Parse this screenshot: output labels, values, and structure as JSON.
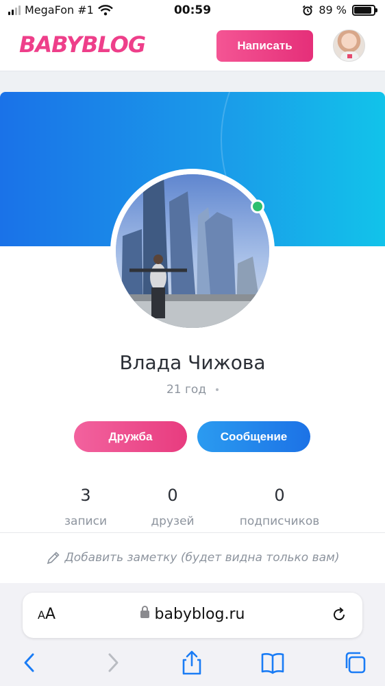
{
  "status_bar": {
    "carrier": "MegaFon #1",
    "time": "00:59",
    "battery_percent": "89 %",
    "battery_level": 0.89
  },
  "header": {
    "logo": "BABYBLOG",
    "write_button": "Написать"
  },
  "profile": {
    "name": "Влада Чижова",
    "age": "21 год",
    "online": true,
    "friend_button": "Дружба",
    "message_button": "Сообщение",
    "stats": [
      {
        "value": "3",
        "label": "записи"
      },
      {
        "value": "0",
        "label": "друзей"
      },
      {
        "value": "0",
        "label": "подписчиков"
      }
    ],
    "note": "Добавить заметку (будет видна только вам)"
  },
  "browser": {
    "text_size_label": "AA",
    "url": "babyblog.ru"
  },
  "colors": {
    "brand_pink": "#ee3f8a",
    "accent_blue": "#1c72e6",
    "online_green": "#2ebf6f",
    "ios_blue": "#1a7cf5"
  },
  "icons": [
    "signal-icon",
    "wifi-icon",
    "alarm-icon",
    "battery-icon",
    "pencil-icon",
    "lock-icon",
    "reload-icon",
    "back-icon",
    "forward-icon",
    "share-icon",
    "bookmarks-icon",
    "tabs-icon"
  ]
}
